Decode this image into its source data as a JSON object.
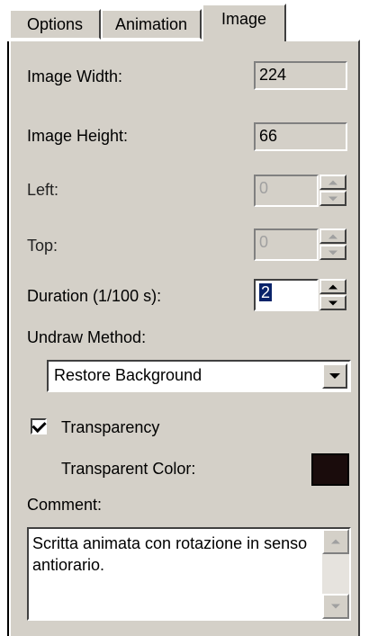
{
  "tabs": [
    {
      "label": "Options"
    },
    {
      "label": "Animation"
    },
    {
      "label": "Image"
    }
  ],
  "active_tab": "Image",
  "fields": {
    "image_width": {
      "label": "Image Width:",
      "value": "224"
    },
    "image_height": {
      "label": "Image Height:",
      "value": "66"
    },
    "left": {
      "label": "Left:",
      "value": "0"
    },
    "top": {
      "label": "Top:",
      "value": "0"
    },
    "duration": {
      "label": "Duration (1/100 s):",
      "value": "2"
    }
  },
  "undraw": {
    "label": "Undraw Method:",
    "selected": "Restore Background"
  },
  "transparency": {
    "label": "Transparency",
    "checked": true,
    "color_label": "Transparent Color:",
    "color": "#1a0c0c"
  },
  "comment": {
    "label": "Comment:",
    "text": "Scritta animata con rotazione in senso antiorario."
  },
  "icons": {
    "spin_up": "spin-up-icon",
    "spin_down": "spin-down-icon",
    "dropdown": "chevron-down-icon",
    "check": "checkmark-icon"
  }
}
